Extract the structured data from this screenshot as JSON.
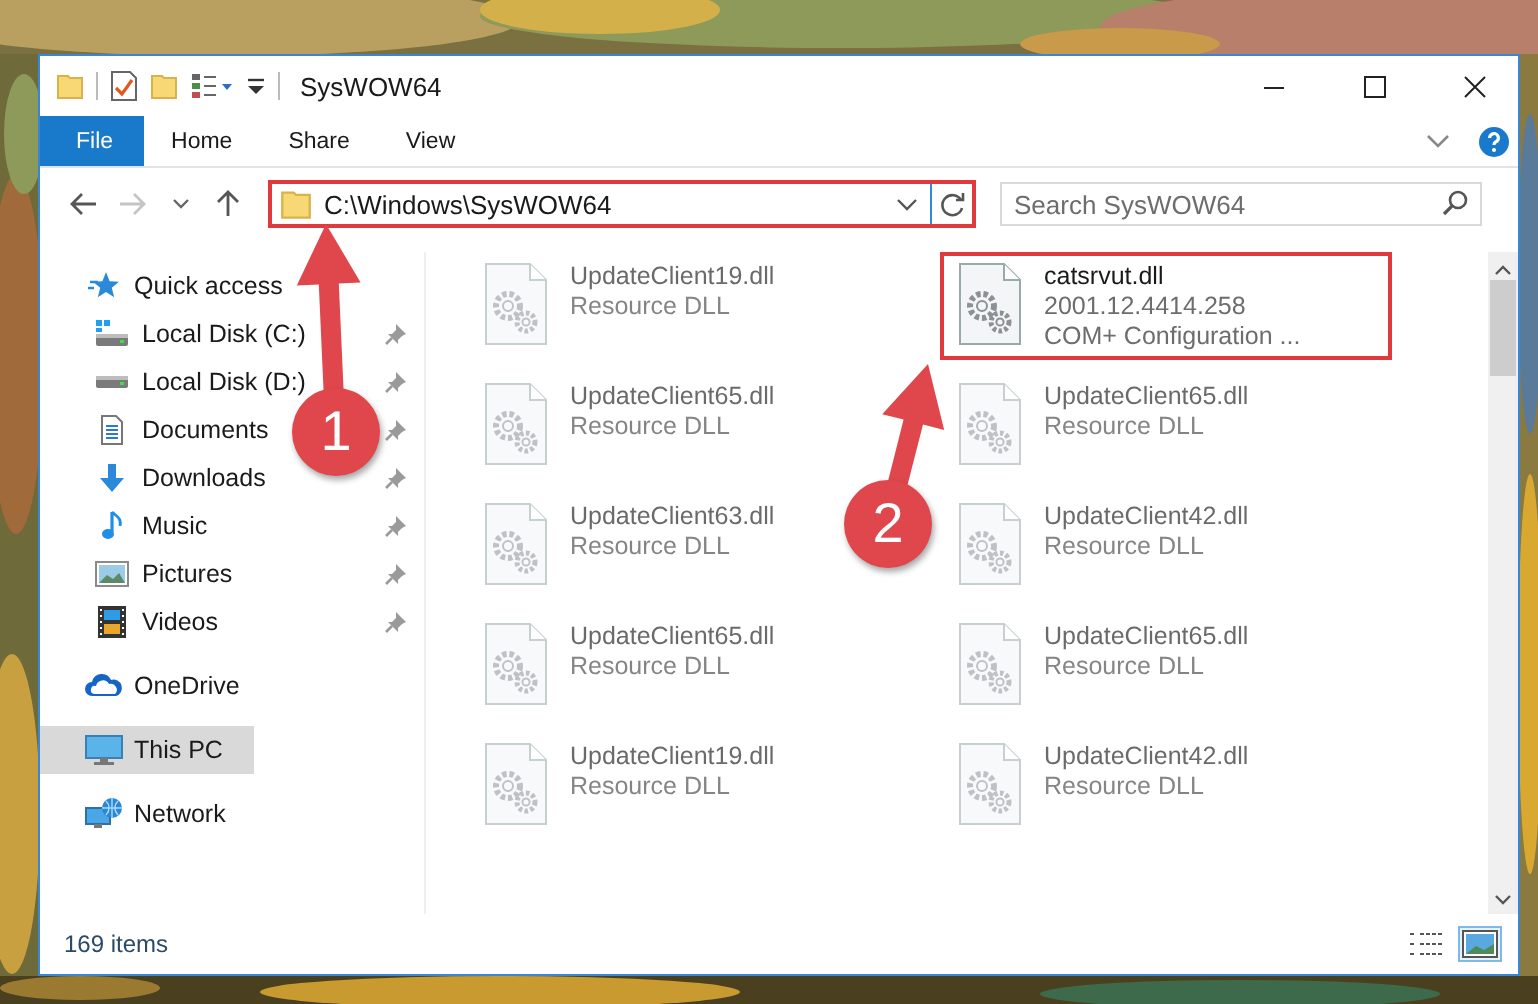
{
  "window": {
    "title": "SysWOW64"
  },
  "ribbon": {
    "tabs": [
      {
        "label": "File",
        "kind": "file"
      },
      {
        "label": "Home",
        "kind": "tab"
      },
      {
        "label": "Share",
        "kind": "tab"
      },
      {
        "label": "View",
        "kind": "tab"
      }
    ]
  },
  "address": {
    "path": "C:\\Windows\\SysWOW64",
    "highlighted": true
  },
  "search": {
    "placeholder": "Search SysWOW64"
  },
  "sidebar": {
    "items": [
      {
        "label": "Quick access",
        "kind": "star",
        "selected": false,
        "children": [
          {
            "label": "Local Disk (C:)",
            "kind": "system-drive",
            "pinned": true,
            "selected": false
          },
          {
            "label": "Local Disk (D:)",
            "kind": "drive",
            "pinned": true,
            "selected": false
          },
          {
            "label": "Documents",
            "kind": "documents",
            "pinned": true,
            "selected": false
          },
          {
            "label": "Downloads",
            "kind": "downloads",
            "pinned": true,
            "selected": false
          },
          {
            "label": "Music",
            "kind": "music",
            "pinned": true,
            "selected": false
          },
          {
            "label": "Pictures",
            "kind": "pictures",
            "pinned": true,
            "selected": false
          },
          {
            "label": "Videos",
            "kind": "videos",
            "pinned": true,
            "selected": false
          }
        ]
      },
      {
        "label": "OneDrive",
        "kind": "cloud",
        "selected": false
      },
      {
        "label": "This PC",
        "kind": "computer",
        "selected": true
      },
      {
        "label": "Network",
        "kind": "network",
        "selected": false
      }
    ]
  },
  "files": [
    {
      "name": "UpdateClient19.dll",
      "type": "Resource DLL",
      "blurred": true,
      "highlighted": false
    },
    {
      "name": "catsrvut.dll",
      "version": "2001.12.4414.258",
      "description": "COM+ Configuration ...",
      "blurred": false,
      "highlighted": true
    },
    {
      "name": "UpdateClient65.dll",
      "type": "Resource DLL",
      "blurred": true,
      "highlighted": false
    },
    {
      "name": "UpdateClient65.dll",
      "type": "Resource DLL",
      "blurred": true,
      "highlighted": false
    },
    {
      "name": "UpdateClient63.dll",
      "type": "Resource DLL",
      "blurred": true,
      "highlighted": false
    },
    {
      "name": "UpdateClient42.dll",
      "type": "Resource DLL",
      "blurred": true,
      "highlighted": false
    },
    {
      "name": "UpdateClient65.dll",
      "type": "Resource DLL",
      "blurred": true,
      "highlighted": false
    },
    {
      "name": "UpdateClient65.dll",
      "type": "Resource DLL",
      "blurred": true,
      "highlighted": false
    },
    {
      "name": "UpdateClient19.dll",
      "type": "Resource DLL",
      "blurred": true,
      "highlighted": false
    },
    {
      "name": "UpdateClient42.dll",
      "type": "Resource DLL",
      "blurred": true,
      "highlighted": false
    }
  ],
  "status_bar": {
    "item_count": "169 items"
  },
  "callouts": [
    {
      "number": "1"
    },
    {
      "number": "2"
    }
  ]
}
